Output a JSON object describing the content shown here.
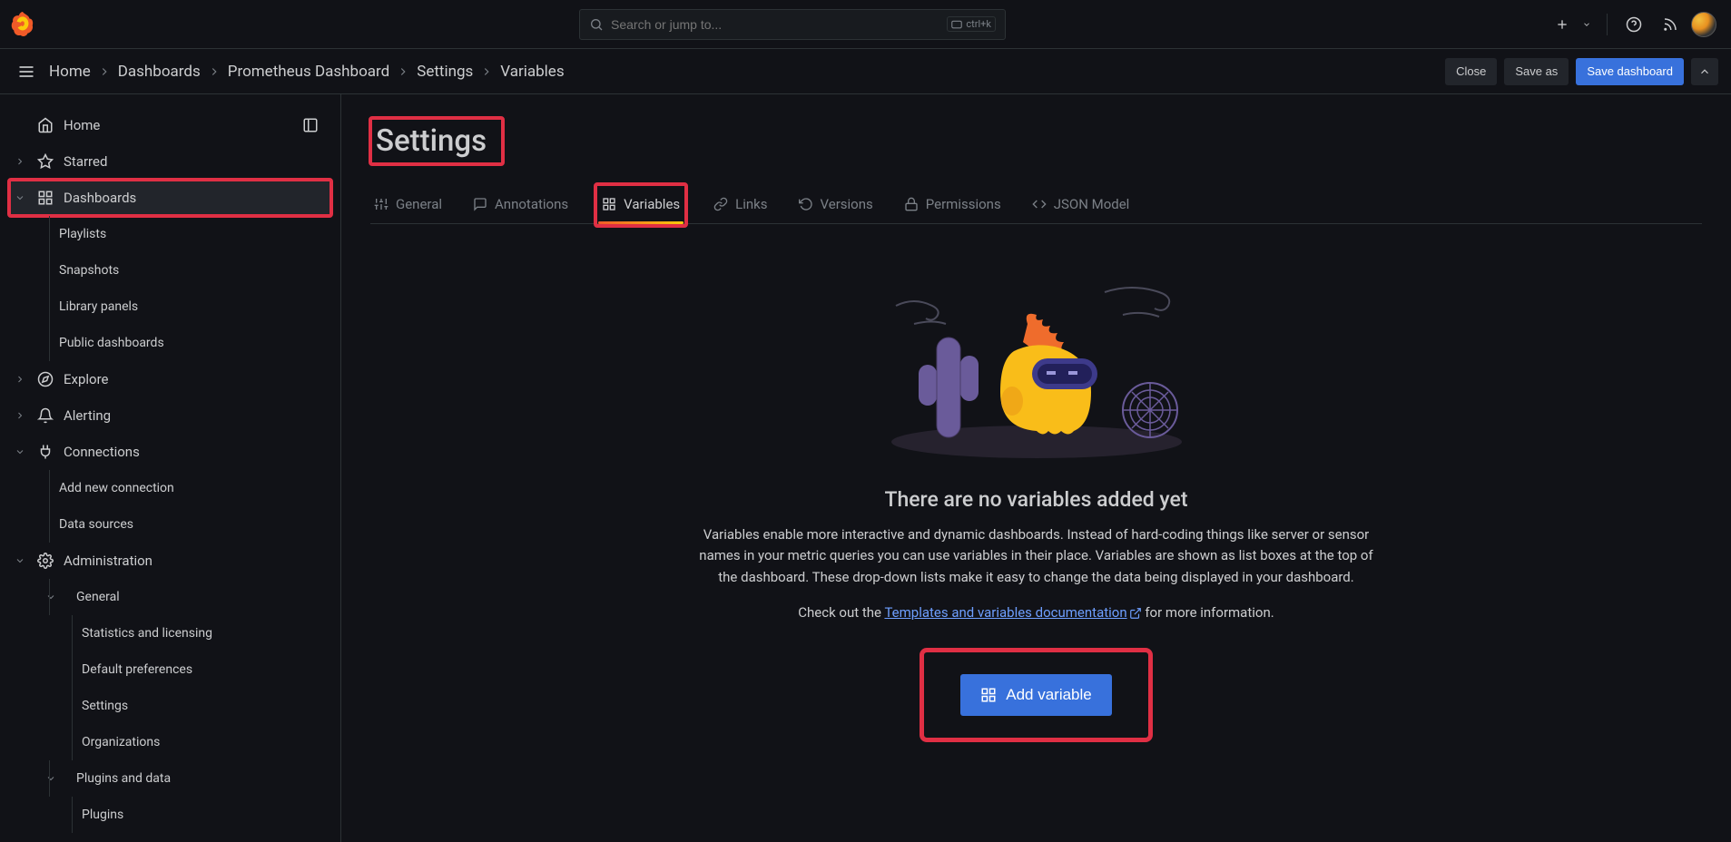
{
  "search": {
    "placeholder": "Search or jump to...",
    "shortcut": "ctrl+k"
  },
  "topbar": {
    "close": "Close",
    "save_as": "Save as",
    "save_dashboard": "Save dashboard"
  },
  "breadcrumbs": {
    "items": [
      "Home",
      "Dashboards",
      "Prometheus Dashboard",
      "Settings",
      "Variables"
    ]
  },
  "sidebar": {
    "home": "Home",
    "starred": "Starred",
    "dashboards": "Dashboards",
    "playlists": "Playlists",
    "snapshots": "Snapshots",
    "library_panels": "Library panels",
    "public_dashboards": "Public dashboards",
    "explore": "Explore",
    "alerting": "Alerting",
    "connections": "Connections",
    "add_new_connection": "Add new connection",
    "data_sources": "Data sources",
    "administration": "Administration",
    "general": "General",
    "stats_licensing": "Statistics and licensing",
    "default_prefs": "Default preferences",
    "settings": "Settings",
    "organizations": "Organizations",
    "plugins_and_data": "Plugins and data",
    "plugins": "Plugins"
  },
  "page": {
    "title": "Settings"
  },
  "tabs": {
    "general": "General",
    "annotations": "Annotations",
    "variables": "Variables",
    "links": "Links",
    "versions": "Versions",
    "permissions": "Permissions",
    "json_model": "JSON Model"
  },
  "empty": {
    "heading": "There are no variables added yet",
    "body": "Variables enable more interactive and dynamic dashboards. Instead of hard-coding things like server or sensor names in your metric queries you can use variables in their place. Variables are shown as list boxes at the top of the dashboard. These drop-down lists make it easy to change the data being displayed in your dashboard.",
    "check_pre": "Check out the ",
    "doc_link": "Templates and variables documentation",
    "check_post": " for more information.",
    "add_button": "Add variable"
  }
}
